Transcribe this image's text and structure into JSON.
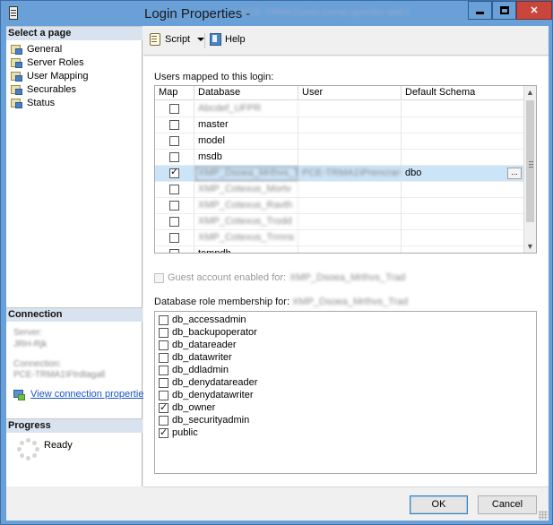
{
  "window": {
    "title": "Login Properties -",
    "title_obscured": "PCE-TRMA1\\user-comp-sprinter-web1"
  },
  "left_pane": {
    "select_page_header": "Select a page",
    "pages": [
      {
        "label": "General",
        "icon": "page-icon"
      },
      {
        "label": "Server Roles",
        "icon": "page-icon"
      },
      {
        "label": "User Mapping",
        "icon": "page-icon",
        "selected": true
      },
      {
        "label": "Securables",
        "icon": "page-icon"
      },
      {
        "label": "Status",
        "icon": "page-icon"
      }
    ],
    "connection_header": "Connection",
    "connection_lines_obscured": [
      "Server:",
      "JRH-Rjk",
      "Connection:",
      "PCE-TRMA1\\Ftrdtagall"
    ],
    "view_connection_properties": "View connection properties",
    "progress_header": "Progress",
    "progress_status": "Ready"
  },
  "toolbar": {
    "script_label": "Script",
    "help_label": "Help"
  },
  "user_mapping": {
    "users_mapped_label": "Users mapped to this login:",
    "columns": [
      "Map",
      "Database",
      "User",
      "Default Schema"
    ],
    "rows": [
      {
        "map": false,
        "database": "Abcdef_UFPR",
        "database_obscured": true,
        "user": "",
        "schema": ""
      },
      {
        "map": false,
        "database": "master",
        "database_obscured": false,
        "user": "",
        "schema": ""
      },
      {
        "map": false,
        "database": "model",
        "database_obscured": false,
        "user": "",
        "schema": ""
      },
      {
        "map": false,
        "database": "msdb",
        "database_obscured": false,
        "user": "",
        "schema": ""
      },
      {
        "map": true,
        "database": "XMP_Dsoea_Mrthvs_Trad",
        "database_obscured": true,
        "user": "PCE-TRMA1\\Prencranp",
        "user_obscured": true,
        "schema": "dbo",
        "selected": true
      },
      {
        "map": false,
        "database": "XMP_Cotexus_Mortv",
        "database_obscured": true,
        "user": "",
        "schema": ""
      },
      {
        "map": false,
        "database": "XMP_Cotexus_Ravth",
        "database_obscured": true,
        "user": "",
        "schema": ""
      },
      {
        "map": false,
        "database": "XMP_Cotexus_Trodd",
        "database_obscured": true,
        "user": "",
        "schema": ""
      },
      {
        "map": false,
        "database": "XMP_Cotexus_Trmns",
        "database_obscured": true,
        "user": "",
        "schema": ""
      },
      {
        "map": false,
        "database": "tempdb",
        "database_obscured": false,
        "user": "",
        "schema": ""
      }
    ],
    "ellipsis": "...",
    "guest_label": "Guest account enabled for:",
    "guest_target_obscured": "XMP_Dsoea_Mrthvs_Trad",
    "role_membership_label": "Database role membership for:",
    "role_membership_target_obscured": "XMP_Dsoea_Mrthvs_Trad",
    "roles": [
      {
        "name": "db_accessadmin",
        "checked": false
      },
      {
        "name": "db_backupoperator",
        "checked": false
      },
      {
        "name": "db_datareader",
        "checked": false
      },
      {
        "name": "db_datawriter",
        "checked": false
      },
      {
        "name": "db_ddladmin",
        "checked": false
      },
      {
        "name": "db_denydatareader",
        "checked": false
      },
      {
        "name": "db_denydatawriter",
        "checked": false
      },
      {
        "name": "db_owner",
        "checked": true
      },
      {
        "name": "db_securityadmin",
        "checked": false
      },
      {
        "name": "public",
        "checked": true
      }
    ]
  },
  "buttons": {
    "ok": "OK",
    "cancel": "Cancel"
  }
}
